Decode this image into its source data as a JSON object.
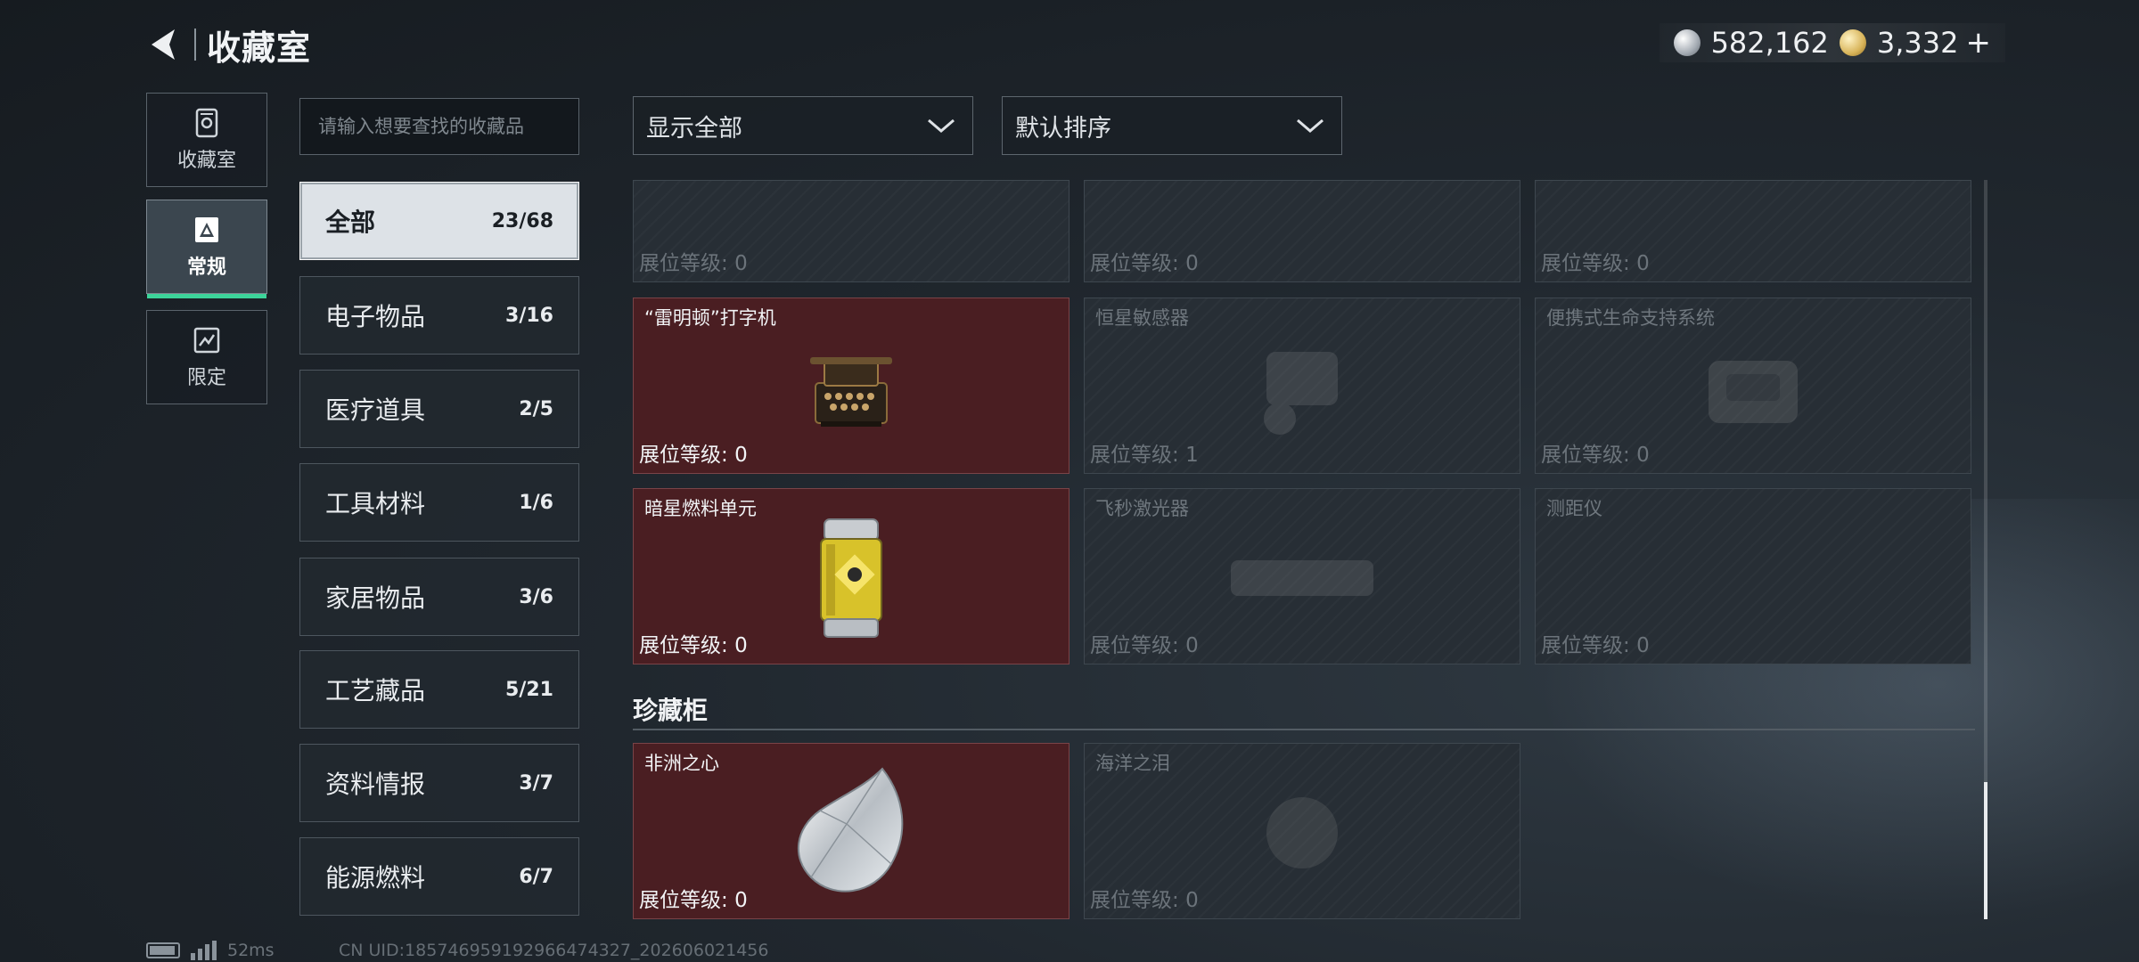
{
  "header": {
    "title": "收藏室"
  },
  "currency": {
    "silver": "582,162",
    "gold": "3,332"
  },
  "side_tabs": [
    {
      "label": "收藏室",
      "icon": "vault-icon"
    },
    {
      "label": "常规",
      "icon": "regular-collection-icon"
    },
    {
      "label": "限定",
      "icon": "limited-collection-icon"
    }
  ],
  "search": {
    "placeholder": "请输入想要查找的收藏品"
  },
  "categories": [
    {
      "name": "全部",
      "count": "23/68"
    },
    {
      "name": "电子物品",
      "count": "3/16"
    },
    {
      "name": "医疗道具",
      "count": "2/5"
    },
    {
      "name": "工具材料",
      "count": "1/6"
    },
    {
      "name": "家居物品",
      "count": "3/6"
    },
    {
      "name": "工艺藏品",
      "count": "5/21"
    },
    {
      "name": "资料情报",
      "count": "3/7"
    },
    {
      "name": "能源燃料",
      "count": "6/7"
    }
  ],
  "filters": {
    "show": "显示全部",
    "sort": "默认排序"
  },
  "level_label": "展位等级:",
  "top_row": [
    {
      "level": "0"
    },
    {
      "level": "0"
    },
    {
      "level": "0"
    }
  ],
  "items": [
    {
      "name": "“雷明顿”打字机",
      "level": "0",
      "owned": true
    },
    {
      "name": "恒星敏感器",
      "level": "1",
      "owned": false
    },
    {
      "name": "便携式生命支持系统",
      "level": "0",
      "owned": false
    },
    {
      "name": "暗星燃料单元",
      "level": "0",
      "owned": true
    },
    {
      "name": "飞秒激光器",
      "level": "0",
      "owned": false
    },
    {
      "name": "测距仪",
      "level": "0",
      "owned": false
    }
  ],
  "section": {
    "title": "珍藏柜"
  },
  "treasures": [
    {
      "name": "非洲之心",
      "level": "0",
      "owned": true
    },
    {
      "name": "海洋之泪",
      "level": "0",
      "owned": false
    }
  ],
  "status": {
    "ping": "52ms",
    "uid": "CN UID:1857469591929​66474327_202606021456"
  }
}
